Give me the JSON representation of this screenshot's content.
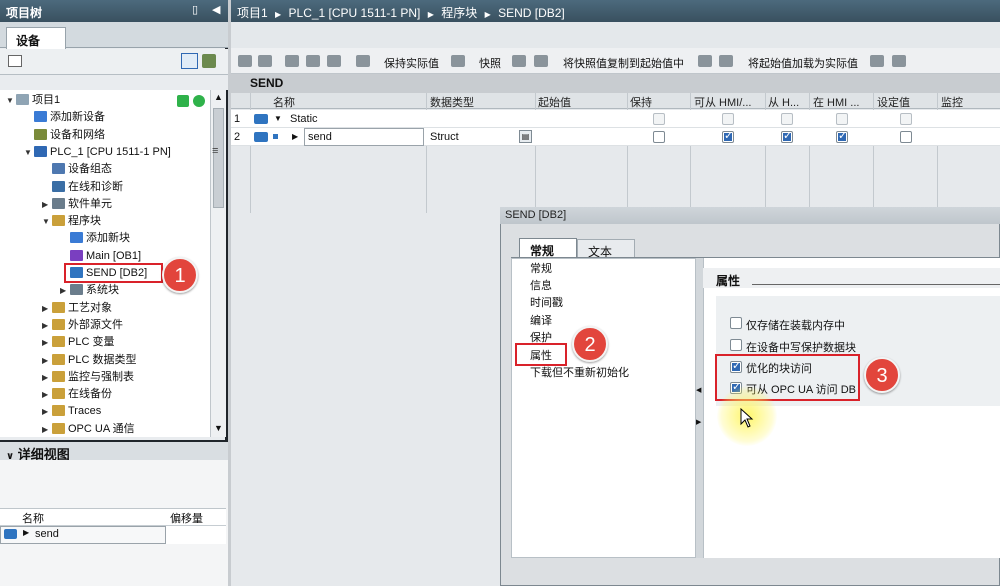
{
  "left": {
    "title": "项目树",
    "tab": "设备",
    "tree": [
      {
        "label": "项目1",
        "level": 0,
        "twisty": "▼"
      },
      {
        "label": "添加新设备",
        "level": 1,
        "twisty": ""
      },
      {
        "label": "设备和网络",
        "level": 1,
        "twisty": ""
      },
      {
        "label": "PLC_1 [CPU 1511-1 PN]",
        "level": 1,
        "twisty": "▼"
      },
      {
        "label": "设备组态",
        "level": 2,
        "twisty": ""
      },
      {
        "label": "在线和诊断",
        "level": 2,
        "twisty": ""
      },
      {
        "label": "软件单元",
        "level": 2,
        "twisty": "▶"
      },
      {
        "label": "程序块",
        "level": 2,
        "twisty": "▼"
      },
      {
        "label": "添加新块",
        "level": 3,
        "twisty": ""
      },
      {
        "label": "Main [OB1]",
        "level": 3,
        "twisty": ""
      },
      {
        "label": "SEND [DB2]",
        "level": 3,
        "twisty": ""
      },
      {
        "label": "系统块",
        "level": 3,
        "twisty": "▶"
      },
      {
        "label": "工艺对象",
        "level": 2,
        "twisty": "▶"
      },
      {
        "label": "外部源文件",
        "level": 2,
        "twisty": "▶"
      },
      {
        "label": "PLC 变量",
        "level": 2,
        "twisty": "▶"
      },
      {
        "label": "PLC 数据类型",
        "level": 2,
        "twisty": "▶"
      },
      {
        "label": "监控与强制表",
        "level": 2,
        "twisty": "▶"
      },
      {
        "label": "在线备份",
        "level": 2,
        "twisty": "▶"
      },
      {
        "label": "Traces",
        "level": 2,
        "twisty": "▶"
      },
      {
        "label": "OPC UA 通信",
        "level": 2,
        "twisty": "▶"
      }
    ],
    "detail": {
      "title": "详细视图",
      "col_name": "名称",
      "col_offset": "偏移量",
      "row_name": "send"
    }
  },
  "breadcrumb": [
    "项目1",
    "PLC_1 [CPU 1511-1 PN]",
    "程序块",
    "SEND [DB2]"
  ],
  "toolbar": {
    "keep_actual": "保持实际值",
    "snapshot": "快照",
    "copy_snapshot": "将快照值复制到起始值中",
    "load_start": "将起始值加载为实际值"
  },
  "db": {
    "name": "SEND",
    "columns": [
      "名称",
      "数据类型",
      "起始值",
      "保持",
      "可从 HMI/...",
      "从 H...",
      "在 HMI ...",
      "设定值",
      "监控"
    ],
    "rows": [
      {
        "num": "1",
        "name": "Static",
        "type": "",
        "retain": false,
        "hmi": false,
        "from_h": false,
        "in_hmi": false,
        "setpoint": false
      },
      {
        "num": "2",
        "name": "send",
        "type": "Struct",
        "retain": false,
        "hmi": true,
        "from_h": true,
        "in_hmi": true,
        "setpoint": false
      }
    ]
  },
  "dialog": {
    "title": "SEND [DB2]",
    "tab_general": "常规",
    "tab_text": "文本",
    "nav": [
      "常规",
      "信息",
      "时间戳",
      "编译",
      "保护",
      "属性",
      "下载但不重新初始化"
    ],
    "section_title": "属性",
    "options": [
      {
        "label": "仅存储在装载内存中",
        "checked": false
      },
      {
        "label": "在设备中写保护数据块",
        "checked": false
      },
      {
        "label": "优化的块访问",
        "checked": true
      },
      {
        "label": "可从 OPC UA 访问 DB",
        "checked": true
      }
    ]
  },
  "badges": [
    "1",
    "2",
    "3"
  ],
  "colors": {
    "title_bar": "#3f5a6b",
    "highlight_red": "#d9222a",
    "badge_red": "#e2453c",
    "check_blue": "#2f68b3"
  }
}
